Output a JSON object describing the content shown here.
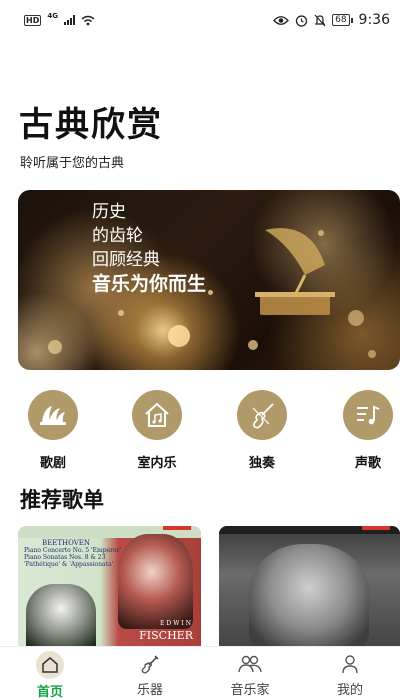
{
  "status_bar": {
    "hd": "HD",
    "network": "4G",
    "battery": "68",
    "time": "9:36"
  },
  "header": {
    "title": "古典欣赏",
    "subtitle": "聆听属于您的古典"
  },
  "banner": {
    "lines": [
      "历史",
      "的齿轮",
      "回顾经典",
      "音乐为你而生"
    ]
  },
  "categories": [
    {
      "label": "歌剧",
      "icon": "opera-house-icon"
    },
    {
      "label": "室内乐",
      "icon": "music-house-icon"
    },
    {
      "label": "独奏",
      "icon": "violin-icon"
    },
    {
      "label": "声歌",
      "icon": "music-list-icon"
    }
  ],
  "section": {
    "title": "推荐歌单"
  },
  "playlists": [
    {
      "cover_composer": "BEETHOVEN",
      "cover_line1": "Piano Concerto No. 5 'Emperor'",
      "cover_line2": "Piano Sonatas Nos. 8 & 23",
      "cover_line3": "'Pathétique' & 'Appassionata'",
      "cover_first_name": "EDWIN",
      "cover_last_name": "FISCHER"
    },
    {
      "cover_strip_text": ""
    }
  ],
  "bottom_nav": [
    {
      "label": "首页",
      "icon": "home-icon",
      "active": true
    },
    {
      "label": "乐器",
      "icon": "guitar-icon",
      "active": false
    },
    {
      "label": "音乐家",
      "icon": "people-icon",
      "active": false
    },
    {
      "label": "我的",
      "icon": "user-icon",
      "active": false
    }
  ],
  "colors": {
    "accent": "#b09a6a",
    "active_nav": "#16a34a"
  }
}
